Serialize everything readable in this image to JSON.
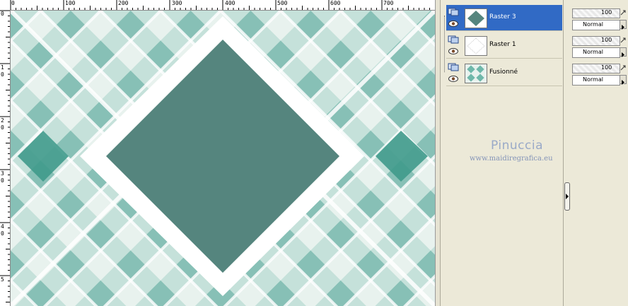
{
  "ruler": {
    "top_labels": [
      "0",
      "100",
      "200",
      "300",
      "400",
      "500",
      "600",
      "700"
    ],
    "left_labels": [
      "0",
      "1",
      "0",
      "2",
      "0",
      "3",
      "0",
      "4",
      "0",
      "5"
    ]
  },
  "layers": [
    {
      "name": "Raster 3",
      "selected": true,
      "opacity": "100",
      "blend_mode": "Normal"
    },
    {
      "name": "Raster 1",
      "selected": false,
      "opacity": "100",
      "blend_mode": "Normal"
    },
    {
      "name": "Fusionné",
      "selected": false,
      "opacity": "100",
      "blend_mode": "Normal"
    }
  ],
  "watermark": {
    "title": "Pinuccia",
    "url": "www.maidiregrafica.eu"
  },
  "colors": {
    "teal_dark": "#55857e",
    "teal_mid": "#5fb3a6",
    "teal_light": "#bfe0d8",
    "selection": "#316ac5",
    "panel_bg": "#ece9d8"
  }
}
